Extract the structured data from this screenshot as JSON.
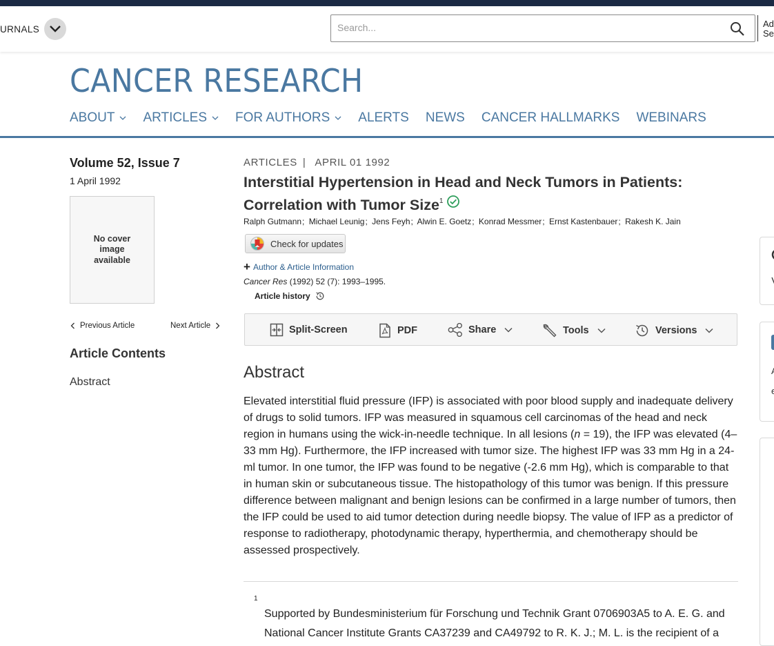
{
  "header": {
    "journals_label": "URNALS",
    "search_placeholder": "Search...",
    "advanced_line1": "Ad",
    "advanced_line2": "Se"
  },
  "journal": {
    "title": "CANCER RESEARCH",
    "nav": [
      {
        "label": "ABOUT",
        "has_dropdown": true
      },
      {
        "label": "ARTICLES",
        "has_dropdown": true
      },
      {
        "label": "FOR AUTHORS",
        "has_dropdown": true
      },
      {
        "label": "ALERTS",
        "has_dropdown": false
      },
      {
        "label": "NEWS",
        "has_dropdown": false
      },
      {
        "label": "CANCER HALLMARKS",
        "has_dropdown": false
      },
      {
        "label": "WEBINARS",
        "has_dropdown": false
      }
    ]
  },
  "sidebar": {
    "volume": "Volume 52, Issue 7",
    "date": "1 April 1992",
    "cover_text": "No cover image available",
    "prev_label": "Previous Article",
    "next_label": "Next Article",
    "contents_heading": "Article Contents",
    "contents_items": [
      "Abstract"
    ]
  },
  "article": {
    "type": "ARTICLES",
    "meta_separator": "|",
    "date": "APRIL 01 1992",
    "title": "Interstitial Hypertension in Head and Neck Tumors in Patients: Correlation with Tumor Size",
    "title_footnote": "1",
    "authors": [
      "Ralph Gutmann",
      "Michael Leunig",
      "Jens Feyh",
      "Alwin E. Goetz",
      "Konrad Messmer",
      "Ernst Kastenbauer",
      "Rakesh K. Jain"
    ],
    "author_separator": ";",
    "check_updates_label": "Check for updates",
    "author_info_label": "Author & Article Information",
    "citation_journal": "Cancer Res",
    "citation_rest": " (1992) 52 (7): 1993–1995.",
    "history_label": "Article history"
  },
  "toolbar": {
    "split_screen": "Split-Screen",
    "pdf": "PDF",
    "share": "Share",
    "tools": "Tools",
    "versions": "Versions"
  },
  "abstract": {
    "heading": "Abstract",
    "text_before_n": "Elevated interstitial fluid pressure (IFP) is associated with poor blood supply and inadequate delivery of drugs to solid tumors. IFP was measured in squamous cell carcinomas of the head and neck region in humans using the wick-in-needle technique. In all lesions (",
    "n_symbol": "n",
    "text_after_n": " = 19), the IFP was elevated (4–33 mm Hg). Furthermore, the IFP increased with tumor size. The highest IFP was 33 mm Hg in a 24-ml tumor. In one tumor, the IFP was found to be negative (-2.6 mm Hg), which is comparable to that in human skin or subcutaneous tissue. The histopathology of this tumor was benign. If this pressure difference between malignant and benign lesions can be confirmed in a large number of tumors, then the IFP could be used to aid tumor detection during needle biopsy. The value of IFP as a predictor of response to radiotherapy, photodynamic therapy, hyperthermia, and chemotherapy should be assessed prospectively."
  },
  "footnote": {
    "number": "1",
    "text": "Supported by Bundesministerium für Forschung und Technik Grant 0706903A5 to A. E. G. and National Cancer Institute Grants CA37239 and CA49792 to R. K. J.; M. L. is the recipient of a"
  },
  "right_rail": {
    "card2_line1": "A",
    "card2_line2": "e"
  },
  "colors": {
    "brand_blue": "#4a78a1",
    "top_bar": "#1b2a44",
    "verified_green": "#2e9e5b",
    "link_blue": "#2a5d8c"
  }
}
